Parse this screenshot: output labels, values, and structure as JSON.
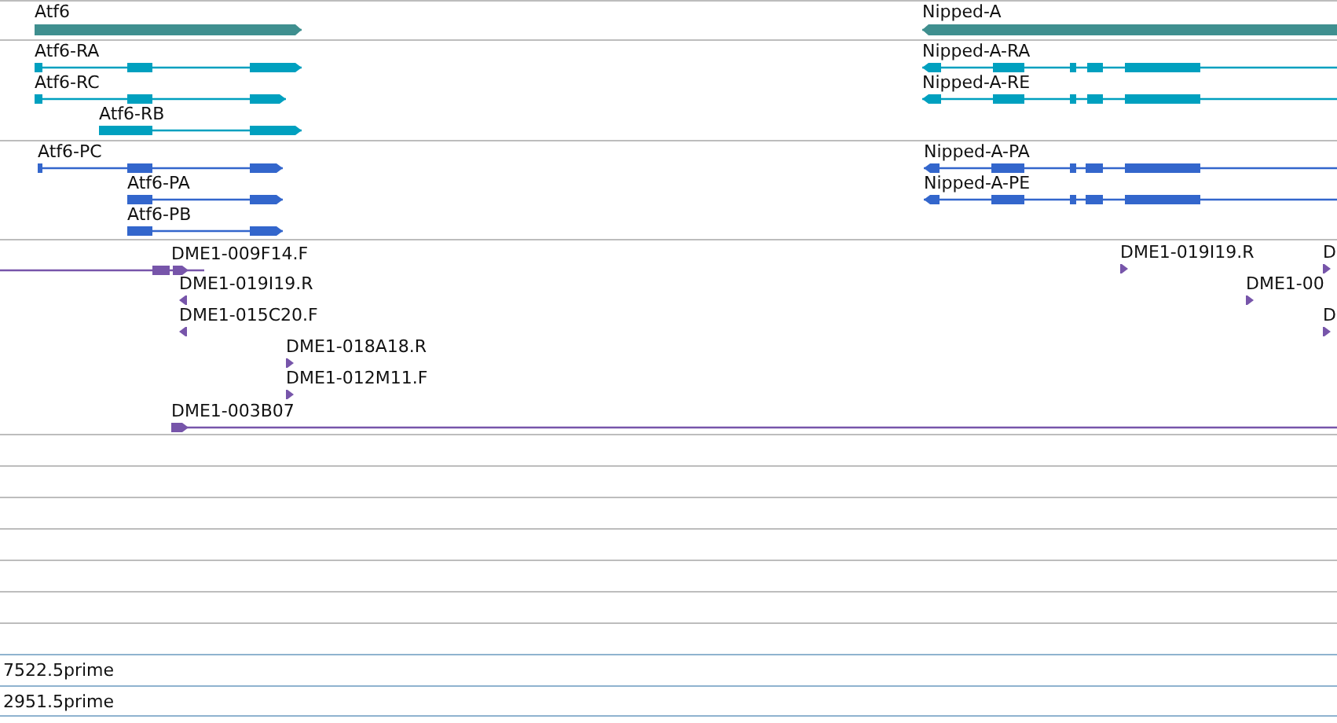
{
  "tracks": [
    {
      "kind": "genes",
      "features": [
        {
          "label": "Atf6",
          "reverse": false
        },
        {
          "label": "Nipped-A",
          "reverse": true
        }
      ]
    },
    {
      "kind": "transcripts",
      "features": [
        {
          "label": "Atf6-RA",
          "reverse": false
        },
        {
          "label": "Atf6-RC",
          "reverse": false
        },
        {
          "label": "Atf6-RB",
          "reverse": false
        },
        {
          "label": "Nipped-A-RA",
          "reverse": true
        },
        {
          "label": "Nipped-A-RE",
          "reverse": true
        }
      ]
    },
    {
      "kind": "proteins",
      "features": [
        {
          "label": "Atf6-PC",
          "reverse": false
        },
        {
          "label": "Atf6-PA",
          "reverse": false
        },
        {
          "label": "Atf6-PB",
          "reverse": false
        },
        {
          "label": "Nipped-A-PA",
          "reverse": true
        },
        {
          "label": "Nipped-A-PE",
          "reverse": true
        }
      ]
    },
    {
      "kind": "ests",
      "features": [
        {
          "label": "DME1-009F14.F",
          "reverse": false
        },
        {
          "label": "DME1-019I19.R",
          "reverse": true
        },
        {
          "label": "DME1-015C20.F",
          "reverse": true
        },
        {
          "label": "DME1-018A18.R",
          "reverse": false
        },
        {
          "label": "DME1-012M11.F",
          "reverse": false
        },
        {
          "label": "DME1-003B07",
          "reverse": false
        },
        {
          "label": "DME1-019I19.R",
          "reverse": false
        },
        {
          "label": "DME1-00",
          "reverse": false
        },
        {
          "label": "D",
          "reverse": false
        },
        {
          "label": "D",
          "reverse": false
        }
      ]
    }
  ],
  "label_rows": [
    "7522.5prime",
    "2951.5prime"
  ]
}
